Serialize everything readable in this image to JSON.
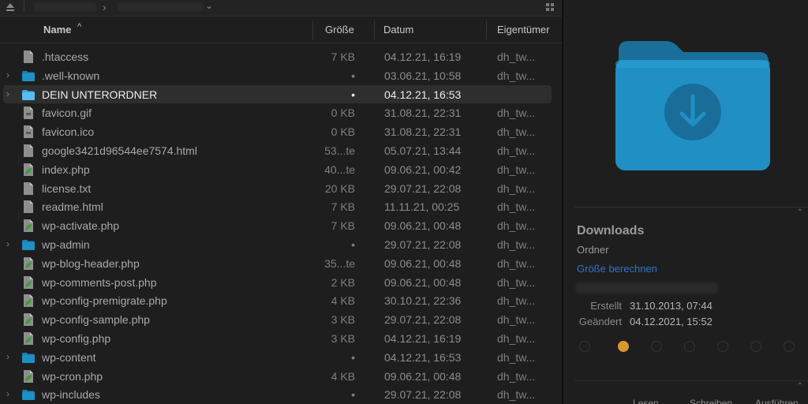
{
  "colors": {
    "background": "#1e1e1e",
    "selection": "#2e2e2c",
    "folder_blue": "#1f8fc4",
    "link_blue": "#3173c7",
    "tag_orange": "#d9952e",
    "php_green": "#3f9b3b"
  },
  "toolbar": {
    "eject_icon": "eject-icon",
    "chevron_icon": "chevron-right-icon",
    "dropdown_icon": "chevron-down-icon",
    "view_icon": "grid-icon"
  },
  "columns": {
    "name": "Name",
    "name_sort_icon": "^",
    "size": "Größe",
    "date": "Datum",
    "owner": "Eigentümer"
  },
  "files": [
    {
      "name": ".htaccess",
      "size": "7 KB",
      "date": "04.12.21, 16:19",
      "owner": "dh_tw...",
      "kind": "file"
    },
    {
      "name": ".well-known",
      "size": "•",
      "date": "03.06.21, 10:58",
      "owner": "dh_tw...",
      "kind": "folder"
    },
    {
      "name": "DEIN UNTERORDNER",
      "size": "•",
      "date": "04.12.21, 16:53",
      "owner": "",
      "kind": "folder-light",
      "selected": true
    },
    {
      "name": "favicon.gif",
      "size": "0 KB",
      "date": "31.08.21, 22:31",
      "owner": "dh_tw...",
      "kind": "image"
    },
    {
      "name": "favicon.ico",
      "size": "0 KB",
      "date": "31.08.21, 22:31",
      "owner": "dh_tw...",
      "kind": "image"
    },
    {
      "name": "google3421d96544ee7574.html",
      "size": "53...te",
      "date": "05.07.21, 13:44",
      "owner": "dh_tw...",
      "kind": "file"
    },
    {
      "name": "index.php",
      "size": "40...te",
      "date": "09.06.21, 00:42",
      "owner": "dh_tw...",
      "kind": "php"
    },
    {
      "name": "license.txt",
      "size": "20 KB",
      "date": "29.07.21, 22:08",
      "owner": "dh_tw...",
      "kind": "file"
    },
    {
      "name": "readme.html",
      "size": "7 KB",
      "date": "11.11.21, 00:25",
      "owner": "dh_tw...",
      "kind": "file"
    },
    {
      "name": "wp-activate.php",
      "size": "7 KB",
      "date": "09.06.21, 00:48",
      "owner": "dh_tw...",
      "kind": "php"
    },
    {
      "name": "wp-admin",
      "size": "•",
      "date": "29.07.21, 22:08",
      "owner": "dh_tw...",
      "kind": "folder"
    },
    {
      "name": "wp-blog-header.php",
      "size": "35...te",
      "date": "09.06.21, 00:48",
      "owner": "dh_tw...",
      "kind": "php"
    },
    {
      "name": "wp-comments-post.php",
      "size": "2 KB",
      "date": "09.06.21, 00:48",
      "owner": "dh_tw...",
      "kind": "php"
    },
    {
      "name": "wp-config-premigrate.php",
      "size": "4 KB",
      "date": "30.10.21, 22:36",
      "owner": "dh_tw...",
      "kind": "php"
    },
    {
      "name": "wp-config-sample.php",
      "size": "3 KB",
      "date": "29.07.21, 22:08",
      "owner": "dh_tw...",
      "kind": "php"
    },
    {
      "name": "wp-config.php",
      "size": "3 KB",
      "date": "04.12.21, 16:19",
      "owner": "dh_tw...",
      "kind": "php"
    },
    {
      "name": "wp-content",
      "size": "•",
      "date": "04.12.21, 16:53",
      "owner": "dh_tw...",
      "kind": "folder"
    },
    {
      "name": "wp-cron.php",
      "size": "4 KB",
      "date": "09.06.21, 00:48",
      "owner": "dh_tw...",
      "kind": "php"
    },
    {
      "name": "wp-includes",
      "size": "•",
      "date": "29.07.21, 22:08",
      "owner": "dh_tw...",
      "kind": "folder"
    }
  ],
  "info": {
    "preview_icon": "downloads-folder-icon",
    "title": "Downloads",
    "kind": "Ordner",
    "calc_size_link": "Größe berechnen",
    "created_label": "Erstellt",
    "created_value": "31.10.2013, 07:44",
    "modified_label": "Geändert",
    "modified_value": "04.12.2021, 15:52",
    "permissions": [
      "Lesen",
      "Schreiben",
      "Ausführen"
    ]
  }
}
